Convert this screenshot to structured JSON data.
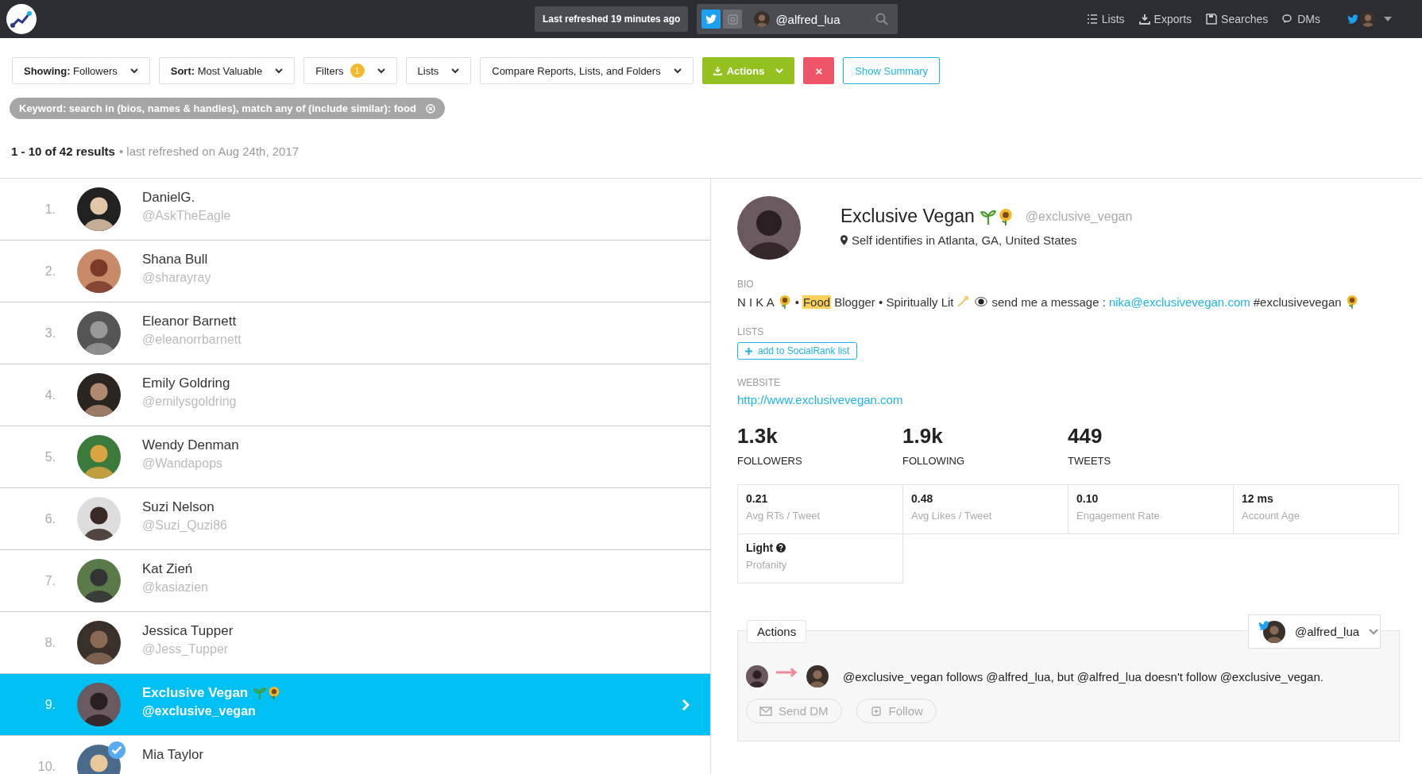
{
  "topbar": {
    "refresh_tooltip": "Last refreshed 19 minutes ago",
    "account": {
      "handle": "@alfred_lua",
      "networks": [
        {
          "kind": "twitter",
          "selected": true
        },
        {
          "kind": "instagram",
          "selected": false
        }
      ]
    },
    "nav": [
      {
        "kind": "lists",
        "label": "Lists"
      },
      {
        "kind": "exports",
        "label": "Exports"
      },
      {
        "kind": "searches",
        "label": "Searches"
      },
      {
        "kind": "dms",
        "label": "DMs"
      }
    ]
  },
  "toolbar": [
    {
      "kind": "dropdown",
      "label": "**Showing:** Followers"
    },
    {
      "kind": "dropdown",
      "label": "**Sort:** Most Valuable"
    },
    {
      "kind": "dropdown",
      "label": "Filters",
      "badge": "1"
    },
    {
      "kind": "dropdown",
      "label": "Lists"
    },
    {
      "kind": "dropdown",
      "label": "Compare Reports, Lists, and Folders"
    },
    {
      "kind": "primary",
      "label": "Actions"
    },
    {
      "kind": "danger",
      "label": "×"
    },
    {
      "kind": "outline",
      "label": "Show Summary"
    }
  ],
  "keyword_chip": "Keyword: search in (bios, names & handles), match any of (include similar): food",
  "results": {
    "count": "1 - 10 of 42 results",
    "refreshed": "• last refreshed on Aug 24th, 2017"
  },
  "rows": [
    {
      "rank": "1.",
      "name": "DanielG.",
      "handle": "@AskTheEagle",
      "selected": false,
      "verified": false,
      "emoji": false
    },
    {
      "rank": "2.",
      "name": "Shana Bull",
      "handle": "@sharayray",
      "selected": false,
      "verified": false,
      "emoji": false
    },
    {
      "rank": "3.",
      "name": "Eleanor Barnett",
      "handle": "@eleanorrbarnett",
      "selected": false,
      "verified": false,
      "emoji": false
    },
    {
      "rank": "4.",
      "name": "Emily Goldring",
      "handle": "@emilysgoldring",
      "selected": false,
      "verified": false,
      "emoji": false
    },
    {
      "rank": "5.",
      "name": "Wendy Denman",
      "handle": "@Wandapops",
      "selected": false,
      "verified": false,
      "emoji": false
    },
    {
      "rank": "6.",
      "name": "Suzi Nelson",
      "handle": "@Suzi_Quzi86",
      "selected": false,
      "verified": false,
      "emoji": false
    },
    {
      "rank": "7.",
      "name": "Kat Zień",
      "handle": "@kasiazien",
      "selected": false,
      "verified": false,
      "emoji": false
    },
    {
      "rank": "8.",
      "name": "Jessica Tupper",
      "handle": "@Jess_Tupper",
      "selected": false,
      "verified": false,
      "emoji": false
    },
    {
      "rank": "9.",
      "name": "Exclusive Vegan",
      "handle": "@exclusive_vegan",
      "selected": true,
      "verified": false,
      "emoji": true
    },
    {
      "rank": "10.",
      "name": "Mia Taylor",
      "selected": false,
      "verified": true,
      "emoji": false
    }
  ],
  "profile": {
    "name": "Exclusive Vegan",
    "emoji": true,
    "handle": "@exclusive_vegan",
    "location": "Self identifies in Atlanta, GA, United States",
    "bio_label": "BIO",
    "bio": {
      "start": "N I K A",
      "after_flower": "•",
      "highlight": "Food",
      "middle": "Blogger • Spiritually Lit",
      "after_eye": "send me a message :",
      "email": "nika@exclusivevegan.com",
      "tag": "#exclusivevegan"
    },
    "lists_label": "LISTS",
    "add_list": "add to SocialRank list",
    "website_label": "WEBSITE",
    "website": "http://www.exclusivevegan.com",
    "stats": [
      {
        "value": "1.3k",
        "label": "FOLLOWERS"
      },
      {
        "value": "1.9k",
        "label": "FOLLOWING"
      },
      {
        "value": "449",
        "label": "TWEETS"
      }
    ],
    "metrics": [
      {
        "value": "0.21",
        "label": "Avg RTs / Tweet",
        "help": false
      },
      {
        "value": "0.48",
        "label": "Avg Likes / Tweet",
        "help": false
      },
      {
        "value": "0.10",
        "label": "Engagement Rate",
        "help": false
      },
      {
        "value": "12 ms",
        "label": "Account Age",
        "help": false
      },
      {
        "value": "Light",
        "label": "Profanity",
        "help": true
      }
    ],
    "actions": {
      "tab": "Actions",
      "account": "@alfred_lua",
      "relation": "@exclusive_vegan follows @alfred_lua, but @alfred_lua doesn't follow @exclusive_vegan.",
      "buttons": [
        {
          "kind": "dm",
          "label": "Send DM"
        },
        {
          "kind": "follow",
          "label": "Follow"
        }
      ]
    }
  }
}
